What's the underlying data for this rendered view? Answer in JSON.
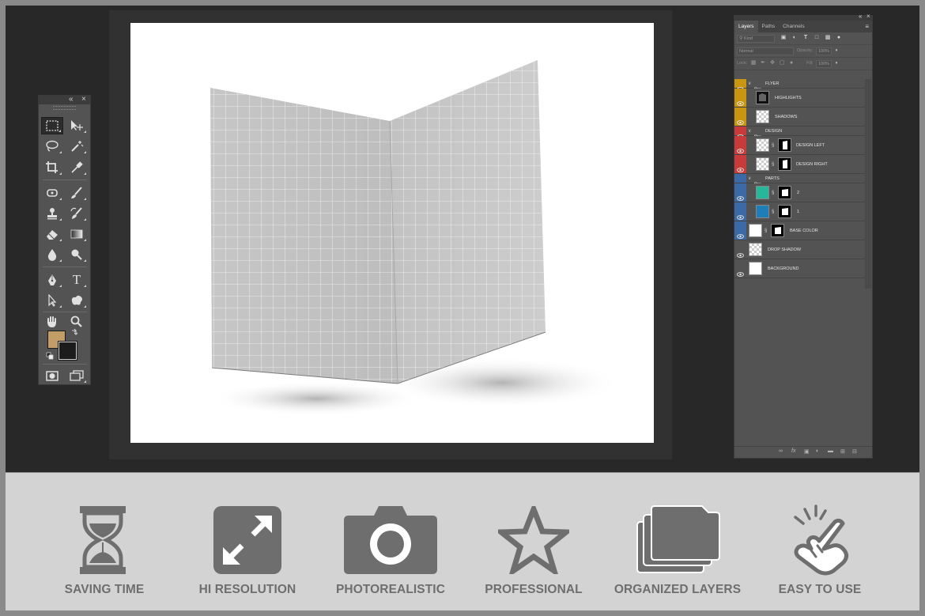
{
  "toolbox": {
    "collapse_icon": "double-chevron-left-icon",
    "close_icon": "close-icon",
    "foreground_color": "#c29d68",
    "background_color": "#1c1c1c",
    "tools": [
      "rectangular-marquee-icon",
      "move-icon",
      "lasso-icon",
      "magic-wand-icon",
      "crop-icon",
      "eyedropper-icon",
      "spot-healing-icon",
      "brush-icon",
      "clone-stamp-icon",
      "history-brush-icon",
      "eraser-icon",
      "gradient-icon",
      "blur-icon",
      "dodge-icon",
      "pen-icon",
      "type-icon",
      "path-selection-icon",
      "custom-shape-icon",
      "hand-icon",
      "zoom-icon",
      "quick-mask-icon",
      "screen-mode-icon"
    ],
    "type_glyph": "T"
  },
  "layers_panel": {
    "tabs": [
      "Layers",
      "Paths",
      "Channels"
    ],
    "active_tab": "Layers",
    "filter_value": "Kind",
    "blend_mode": "Normal",
    "opacity_label": "Opacity:",
    "opacity_value": "100%",
    "lock_label": "Lock:",
    "fill_label": "Fill:",
    "fill_value": "100%",
    "layers": [
      {
        "name": "FLYER",
        "type": "group",
        "color": "#c9960f"
      },
      {
        "name": "HIGHLIGHTS",
        "type": "layer",
        "color": "#c9960f"
      },
      {
        "name": "SHADOWS",
        "type": "layer",
        "color": "#c9960f"
      },
      {
        "name": "DESIGN",
        "type": "group",
        "color": "#c93a3a"
      },
      {
        "name": "DESIGN LEFT",
        "type": "smart",
        "color": "#c93a3a"
      },
      {
        "name": "DESIGN RIGHT",
        "type": "smart",
        "color": "#c93a3a"
      },
      {
        "name": "PARTS",
        "type": "group",
        "color": "#3b6aa6"
      },
      {
        "name": "2",
        "type": "fill",
        "color": "#3b6aa6",
        "thumb_color": "#27b89a"
      },
      {
        "name": "1",
        "type": "fill",
        "color": "#3b6aa6",
        "thumb_color": "#1e7fb8"
      },
      {
        "name": "BASE COLOR",
        "type": "fill",
        "color": "#3b6aa6",
        "thumb_color": "#ffffff"
      },
      {
        "name": "DROP SHADOW",
        "type": "layer",
        "color": "#535353"
      },
      {
        "name": "BACKGROUND",
        "type": "layer",
        "color": "#535353"
      }
    ],
    "footer_icons": [
      "link-icon",
      "fx-icon",
      "mask-icon",
      "adjustment-icon",
      "folder-icon",
      "new-layer-icon",
      "trash-icon"
    ]
  },
  "features": [
    {
      "label": "SAVING TIME",
      "icon": "hourglass-icon"
    },
    {
      "label": "HI RESOLUTION",
      "icon": "expand-arrows-icon"
    },
    {
      "label": "PHOTOREALISTIC",
      "icon": "camera-icon"
    },
    {
      "label": "PROFESSIONAL",
      "icon": "star-icon"
    },
    {
      "label": "ORGANIZED LAYERS",
      "icon": "stacked-folders-icon"
    },
    {
      "label": "EASY TO USE",
      "icon": "pointing-hand-icon"
    }
  ],
  "colors": {
    "feature_icon": "#6e6e6e",
    "feature_bar": "#d3d3d3",
    "workspace": "#282828"
  }
}
